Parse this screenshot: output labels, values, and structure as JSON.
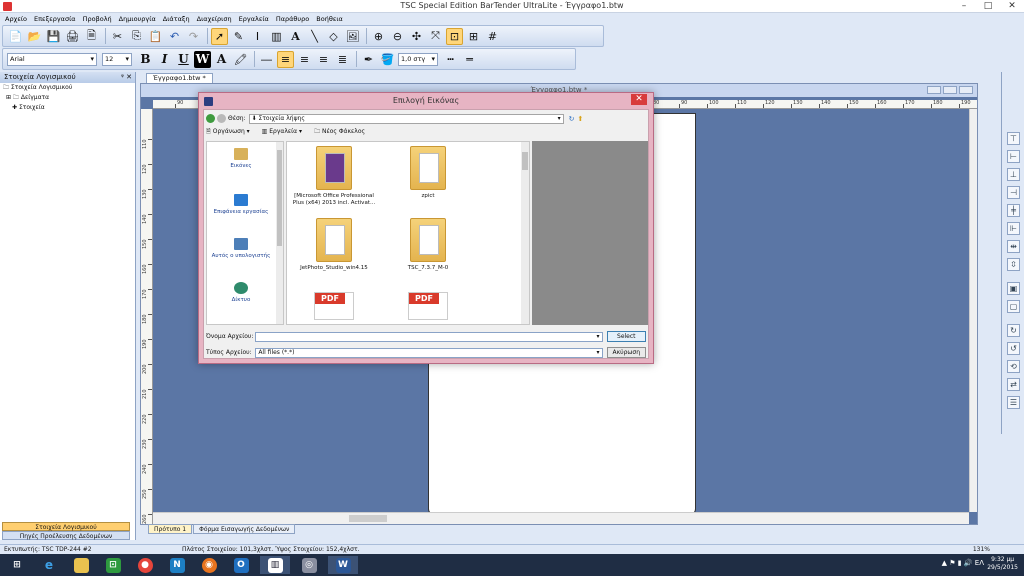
{
  "window": {
    "title": "TSC Special Edition BarTender UltraLite - Έγγραφο1.btw",
    "minimize": "–",
    "maximize": "□",
    "close": "✕"
  },
  "menu": [
    "Αρχείο",
    "Επεξεργασία",
    "Προβολή",
    "Δημιουργία",
    "Διάταξη",
    "Διαχείριση",
    "Εργαλεία",
    "Παράθυρο",
    "Βοήθεια"
  ],
  "toolbar": {
    "font": "Arial",
    "size": "12",
    "bold": "B",
    "italic": "I",
    "underline": "U",
    "white": "W",
    "text_tool": "A",
    "line_width": "1,0 στγ",
    "icons": [
      "new-icon",
      "open-icon",
      "save-icon",
      "print-icon",
      "cut-icon",
      "copy-icon",
      "paste-icon",
      "undo-icon",
      "redo-icon",
      "pointer-icon",
      "barcode-icon",
      "zoom-in-icon",
      "zoom-out-icon",
      "grid-icon"
    ]
  },
  "leftpanel": {
    "title": "Στοιχεία Λογισμικού",
    "tree": [
      "Στοιχεία Λογισμικού",
      "Δείγματα",
      "Στοιχεία"
    ],
    "btn_active": "Στοιχεία Λογισμικού",
    "btn_inactive": "Πηγές Προέλευσης Δεδομένων"
  },
  "document": {
    "tab": "Έγγραφο1.btw *",
    "inner_title": "Έγγραφο1.btw *",
    "ruler_h": [
      "90",
      "80",
      "70",
      "60",
      "50",
      "40",
      "30",
      "20",
      "10",
      "0",
      "10",
      "20",
      "30",
      "40",
      "50",
      "60",
      "70",
      "80",
      "90",
      "100",
      "110",
      "120",
      "130",
      "140",
      "150",
      "160",
      "170",
      "180",
      "190"
    ],
    "ruler_v": [
      "110",
      "120",
      "130",
      "140",
      "150",
      "160",
      "170",
      "180",
      "190",
      "200",
      "210",
      "220",
      "230",
      "240",
      "250",
      "260",
      "270"
    ]
  },
  "bottomtabs": [
    "Πρότυπο 1",
    "Φόρμα Εισαγωγής Δεδομένων"
  ],
  "statusbar": {
    "printer": "Εκτυπωτής: TSC TDP-244 #2",
    "dims": "Πλάτος Στοιχείου: 101,3χλστ.  Ύψος Στοιχείου: 152,4χλστ.",
    "zoom": "131%"
  },
  "dialog": {
    "title": "Επιλογή Εικόνας",
    "close": "✕",
    "location_label": "Θέση:",
    "location": "Στοιχεία λήψης",
    "commands": [
      "Οργάνωση ▾",
      "Εργαλεία ▾",
      "Νέος Φάκελος"
    ],
    "nav": [
      "Εικόνες",
      "Επιφάνεια εργασίας",
      "Αυτός ο υπολογιστής",
      "Δίκτυο"
    ],
    "files": [
      "[Microsoft Office Professional Plus (x64) 2013 incl. Activat...",
      "zpict",
      "JetPhoto_Studio_win4.15",
      "TSC_7.3.7_M-0"
    ],
    "pdf_label": "PDF",
    "filename_label": "Όνομα Αρχείου:",
    "filename": "",
    "filetype_label": "Τύπος Αρχείου:",
    "filetype": "All files (*.*)",
    "select": "Select",
    "cancel": "Ακύρωση"
  },
  "taskbar": {
    "lang": "ΕΛ",
    "time": "9:32 μμ",
    "date": "29/5/2015"
  }
}
